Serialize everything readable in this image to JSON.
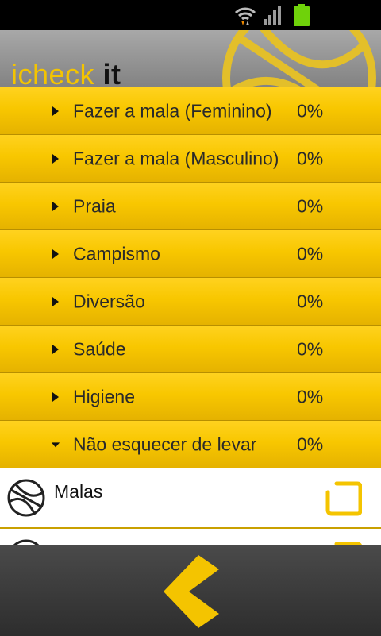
{
  "app": {
    "logo_part1": "icheck",
    "logo_part2": " it"
  },
  "categories": [
    {
      "label": "Fazer a mala (Feminino)",
      "percent": "0%",
      "expanded": false
    },
    {
      "label": "Fazer a mala (Masculino)",
      "percent": "0%",
      "expanded": false
    },
    {
      "label": "Praia",
      "percent": "0%",
      "expanded": false
    },
    {
      "label": "Campismo",
      "percent": "0%",
      "expanded": false
    },
    {
      "label": "Diversão",
      "percent": "0%",
      "expanded": false
    },
    {
      "label": "Saúde",
      "percent": "0%",
      "expanded": false
    },
    {
      "label": "Higiene",
      "percent": "0%",
      "expanded": false
    },
    {
      "label": "Não esquecer de levar",
      "percent": "0%",
      "expanded": true
    }
  ],
  "items": [
    {
      "label": "Malas",
      "checked": false
    }
  ],
  "colors": {
    "accent": "#f4c400",
    "header_gray": "#8e8e8e",
    "bottom_bar": "#333333"
  },
  "icons": {
    "back": "chevron-left-icon",
    "item": "globe-icon",
    "checkbox": "checkbox-icon"
  }
}
